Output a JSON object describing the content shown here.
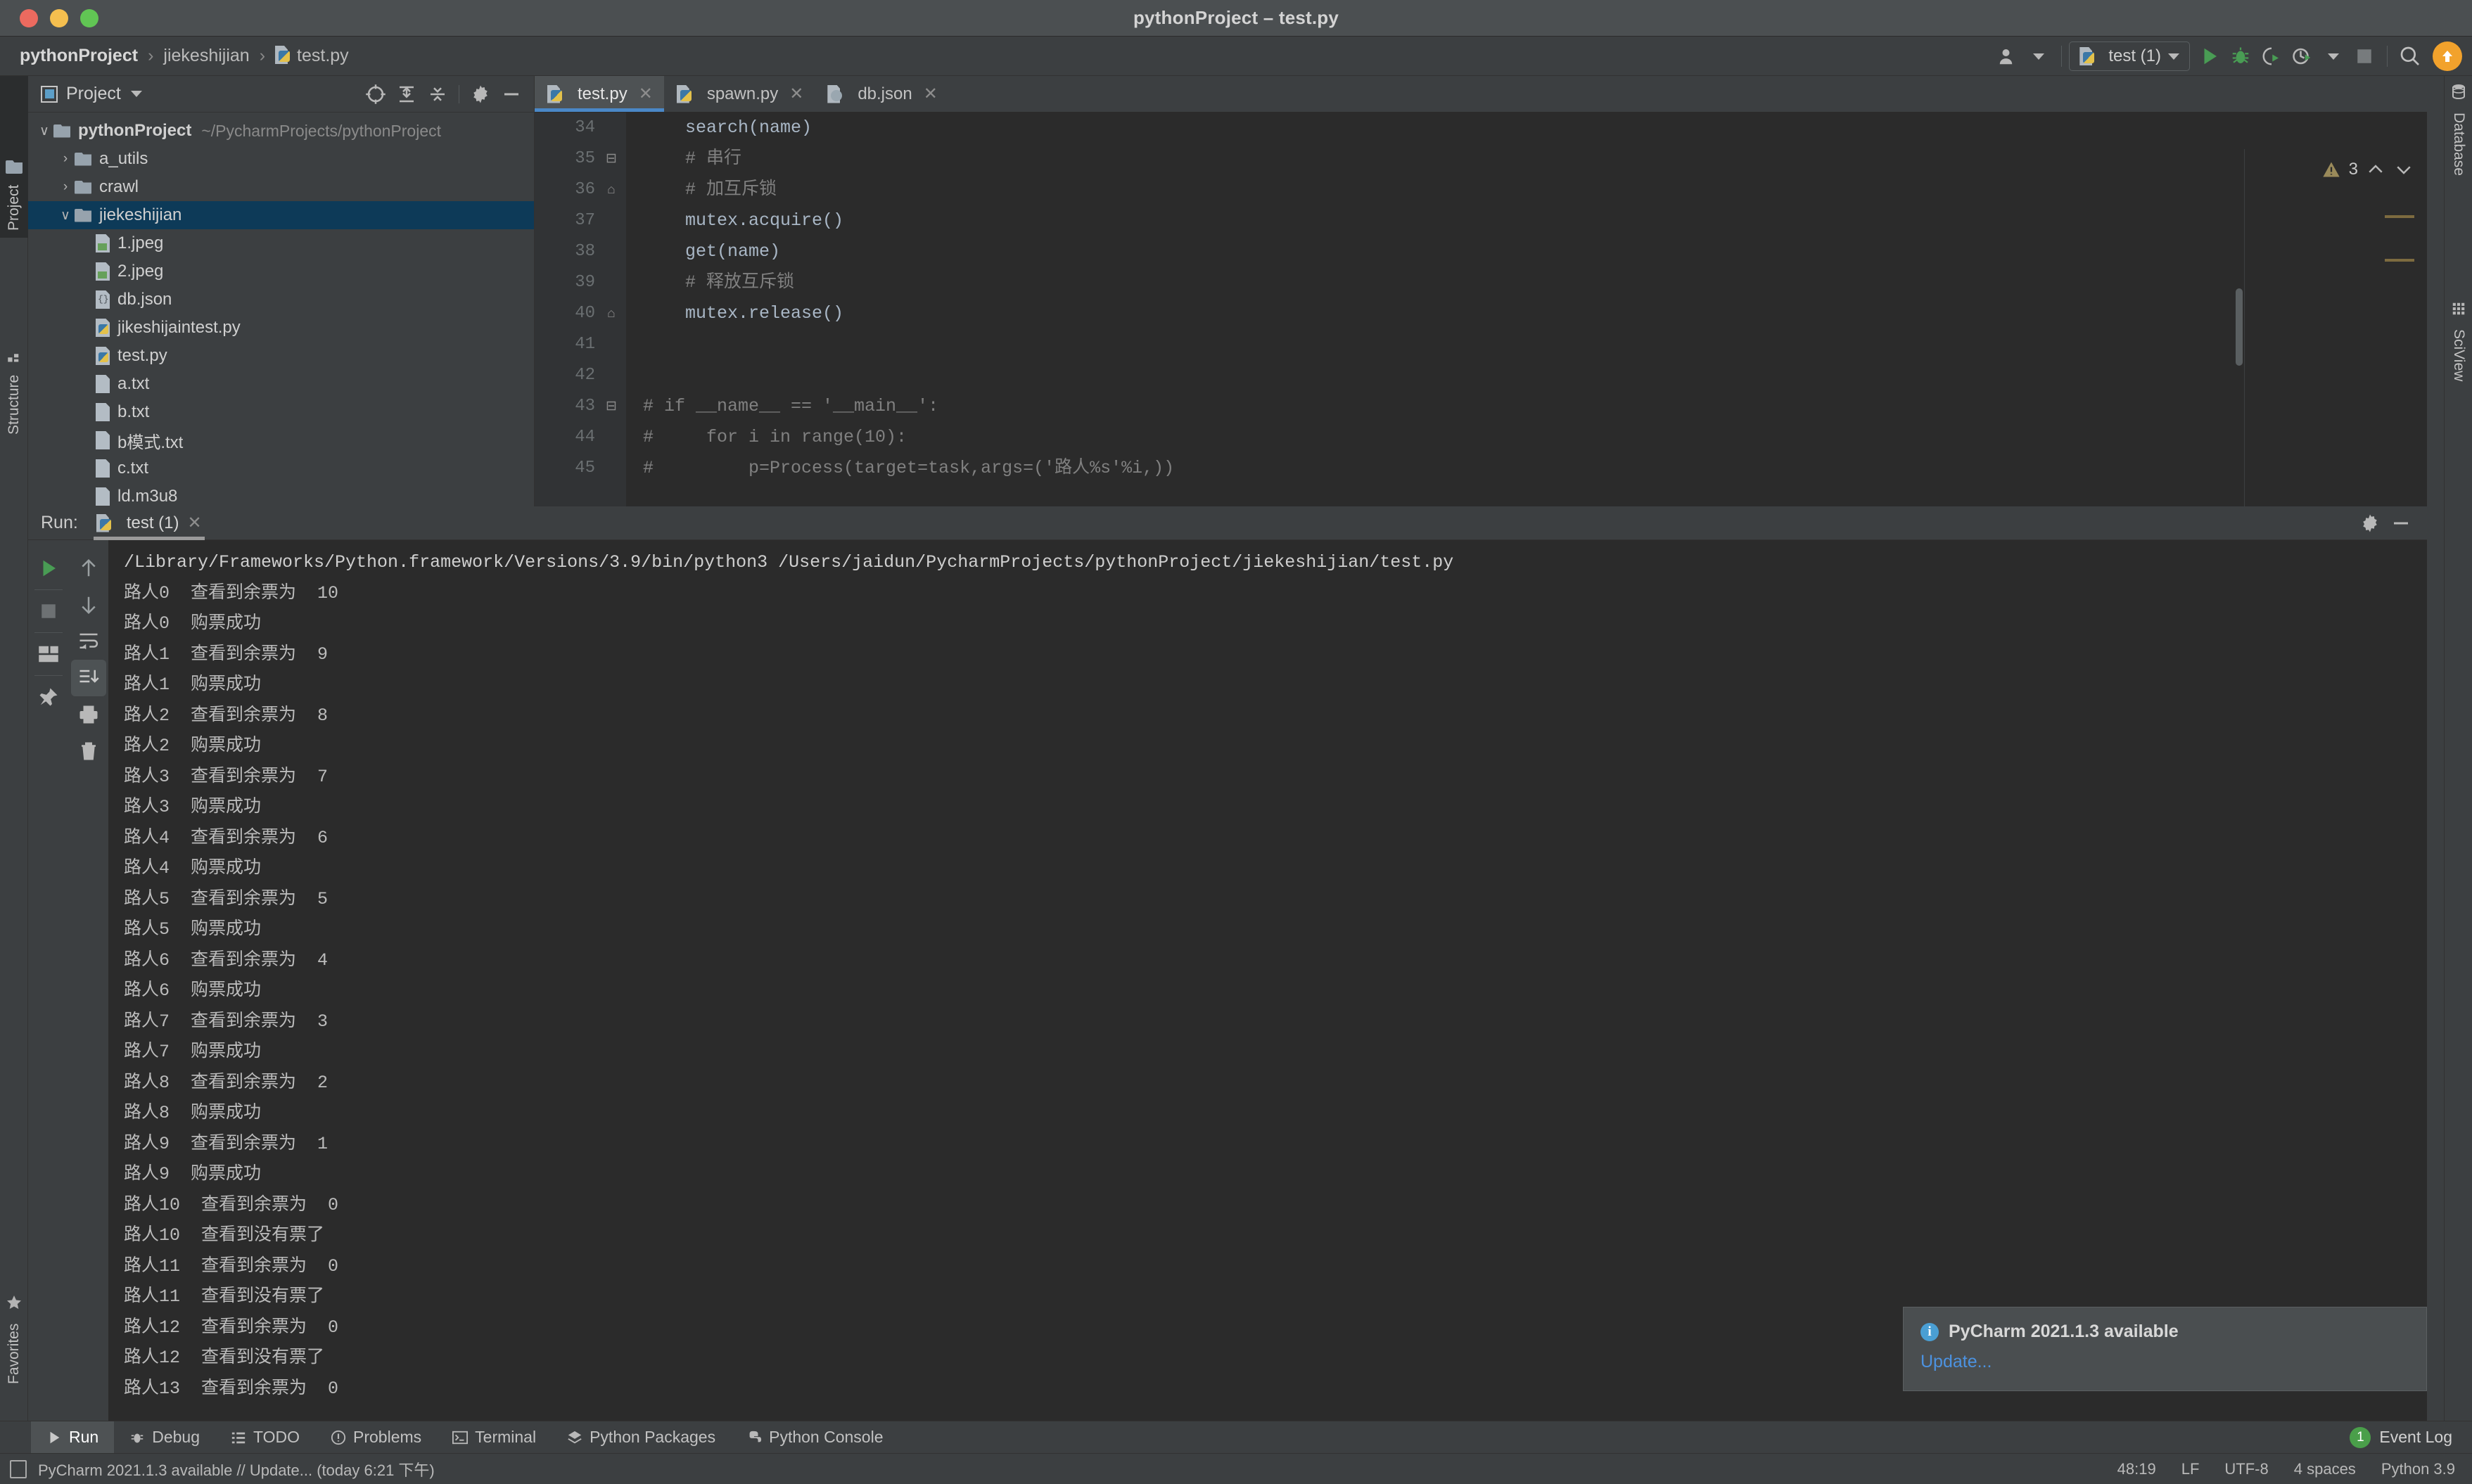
{
  "window": {
    "title": "pythonProject – test.py",
    "traffic_lights": [
      "close",
      "minimize",
      "zoom"
    ]
  },
  "breadcrumb": {
    "items": [
      "pythonProject",
      "jiekeshijian",
      "test.py"
    ],
    "separator": "›"
  },
  "toolbar": {
    "run_config": "test (1)",
    "buttons": [
      "user-icon",
      "run",
      "debug",
      "run-with-coverage",
      "profile",
      "stop",
      "search",
      "update"
    ]
  },
  "left_strip": {
    "tabs": [
      "Project",
      "Structure"
    ],
    "bottom_tabs": [
      "Favorites"
    ]
  },
  "right_strip": {
    "tabs": [
      "Database",
      "SciView"
    ]
  },
  "project_panel": {
    "title": "Project",
    "tools": [
      "locate-icon",
      "expand-all-icon",
      "collapse-all-icon",
      "gear-icon",
      "hide-icon"
    ],
    "tree": [
      {
        "label": "pythonProject",
        "path": "~/PycharmProjects/pythonProject",
        "type": "root",
        "indent": 0,
        "expanded": true,
        "selected": false
      },
      {
        "label": "a_utils",
        "type": "folder",
        "indent": 1,
        "expanded": false,
        "selected": false
      },
      {
        "label": "crawl",
        "type": "folder",
        "indent": 1,
        "expanded": false,
        "selected": false
      },
      {
        "label": "jiekeshijian",
        "type": "folder",
        "indent": 1,
        "expanded": true,
        "selected": true
      },
      {
        "label": "1.jpeg",
        "type": "image",
        "indent": 2,
        "selected": false
      },
      {
        "label": "2.jpeg",
        "type": "image",
        "indent": 2,
        "selected": false
      },
      {
        "label": "db.json",
        "type": "json",
        "indent": 2,
        "selected": false
      },
      {
        "label": "jikeshijaintest.py",
        "type": "python",
        "indent": 2,
        "selected": false
      },
      {
        "label": "test.py",
        "type": "python",
        "indent": 2,
        "selected": false
      },
      {
        "label": "a.txt",
        "type": "text",
        "indent": 2,
        "selected": false
      },
      {
        "label": "b.txt",
        "type": "text",
        "indent": 2,
        "selected": false
      },
      {
        "label": "b模式.txt",
        "type": "text",
        "indent": 2,
        "selected": false
      },
      {
        "label": "c.txt",
        "type": "text",
        "indent": 2,
        "selected": false
      },
      {
        "label": "ld.m3u8",
        "type": "text",
        "indent": 2,
        "selected": false
      }
    ]
  },
  "editor": {
    "tabs": [
      {
        "label": "test.py",
        "type": "python",
        "active": true
      },
      {
        "label": "spawn.py",
        "type": "python",
        "active": false
      },
      {
        "label": "db.json",
        "type": "json",
        "active": false
      }
    ],
    "warning_count": "3",
    "lines": [
      {
        "num": "34",
        "fold": "",
        "text": "    search(name)",
        "kind": "code"
      },
      {
        "num": "35",
        "fold": "⊟",
        "text": "    # 串行",
        "kind": "comment"
      },
      {
        "num": "36",
        "fold": "⌂",
        "text": "    # 加互斥锁",
        "kind": "comment"
      },
      {
        "num": "37",
        "fold": "",
        "text": "    mutex.acquire()",
        "kind": "code"
      },
      {
        "num": "38",
        "fold": "",
        "text": "    get(name)",
        "kind": "code"
      },
      {
        "num": "39",
        "fold": "",
        "text": "    # 释放互斥锁",
        "kind": "comment"
      },
      {
        "num": "40",
        "fold": "⌂",
        "text": "    mutex.release()",
        "kind": "code"
      },
      {
        "num": "41",
        "fold": "",
        "text": "",
        "kind": "code"
      },
      {
        "num": "42",
        "fold": "",
        "text": "",
        "kind": "code"
      },
      {
        "num": "43",
        "fold": "⊟",
        "text": "# if __name__ == '__main__':",
        "kind": "comment"
      },
      {
        "num": "44",
        "fold": "",
        "text": "#     for i in range(10):",
        "kind": "comment"
      },
      {
        "num": "45",
        "fold": "",
        "text": "#         p=Process(target=task,args=('路人%s'%i,))",
        "kind": "comment"
      }
    ]
  },
  "run_panel": {
    "label": "Run:",
    "tab_name": "test (1)",
    "side_buttons": [
      "rerun-icon",
      "stop-icon",
      "layout-icon",
      "pin-icon"
    ],
    "side_buttons2": [
      "up-arrow-icon",
      "down-arrow-icon",
      "soft-wrap-icon",
      "scroll-to-end-icon",
      "print-icon",
      "trash-icon"
    ],
    "header_right": [
      "gear-icon",
      "hide-icon"
    ],
    "console": [
      "/Library/Frameworks/Python.framework/Versions/3.9/bin/python3 /Users/jaidun/PycharmProjects/pythonProject/jiekeshijian/test.py",
      "路人0  查看到余票为  10",
      "路人0  购票成功",
      "路人1  查看到余票为  9",
      "路人1  购票成功",
      "路人2  查看到余票为  8",
      "路人2  购票成功",
      "路人3  查看到余票为  7",
      "路人3  购票成功",
      "路人4  查看到余票为  6",
      "路人4  购票成功",
      "路人5  查看到余票为  5",
      "路人5  购票成功",
      "路人6  查看到余票为  4",
      "路人6  购票成功",
      "路人7  查看到余票为  3",
      "路人7  购票成功",
      "路人8  查看到余票为  2",
      "路人8  购票成功",
      "路人9  查看到余票为  1",
      "路人9  购票成功",
      "路人10  查看到余票为  0",
      "路人10  查看到没有票了",
      "路人11  查看到余票为  0",
      "路人11  查看到没有票了",
      "路人12  查看到余票为  0",
      "路人12  查看到没有票了",
      "路人13  查看到余票为  0"
    ]
  },
  "notification": {
    "title": "PyCharm 2021.1.3 available",
    "link": "Update..."
  },
  "bottom_bar": {
    "items": [
      {
        "label": "Run",
        "icon": "run-icon",
        "active": true
      },
      {
        "label": "Debug",
        "icon": "debug-icon",
        "active": false
      },
      {
        "label": "TODO",
        "icon": "todo-icon",
        "active": false
      },
      {
        "label": "Problems",
        "icon": "problems-icon",
        "active": false
      },
      {
        "label": "Terminal",
        "icon": "terminal-icon",
        "active": false
      },
      {
        "label": "Python Packages",
        "icon": "packages-icon",
        "active": false
      },
      {
        "label": "Python Console",
        "icon": "python-console-icon",
        "active": false
      }
    ],
    "event_log": "Event Log",
    "event_badge": "1"
  },
  "status_bar": {
    "message": "PyCharm 2021.1.3 available  //  Update... (today 6:21 下午)",
    "caret": "48:19",
    "line_sep": "LF",
    "encoding": "UTF-8",
    "indent": "4 spaces",
    "interpreter": "Python 3.9"
  },
  "colors": {
    "accent": "#4a88c7",
    "selection": "#0d3a58",
    "editor_bg": "#2b2b2b",
    "panel_bg": "#3c3f41",
    "update_badge": "#f2a22c",
    "link": "#4c92e0"
  }
}
